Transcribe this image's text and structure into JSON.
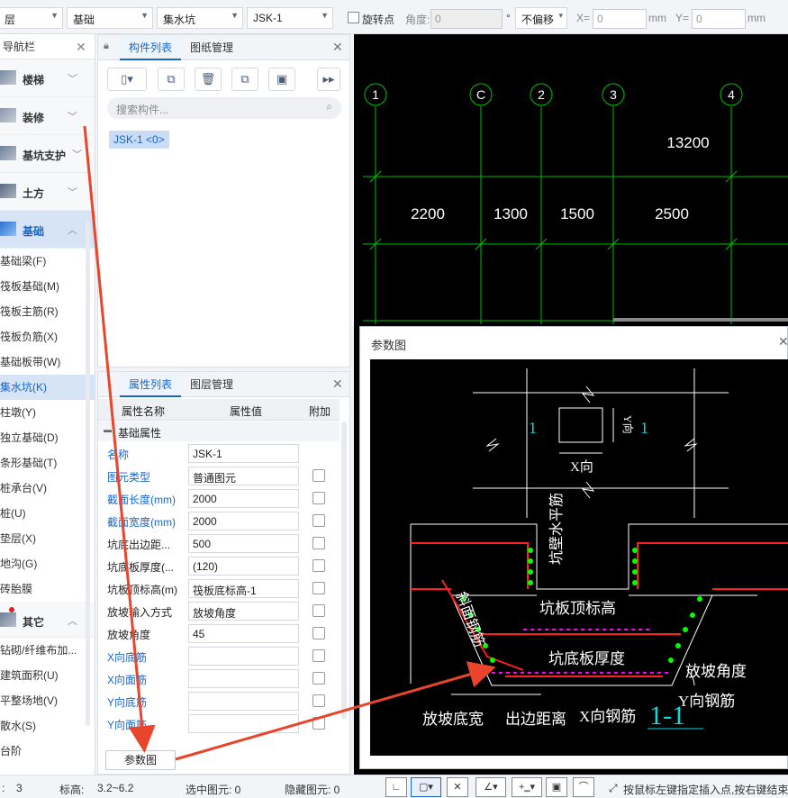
{
  "toolbar": {
    "floor": "层",
    "category": "基础",
    "type": "集水坑",
    "component": "JSK-1",
    "rotate_label": "旋转点",
    "angle_label": "角度:",
    "angle_value": "0",
    "degree": "°",
    "offset_option": "不偏移",
    "x_label": "X=",
    "x_value": "0",
    "x_unit": "mm",
    "y_label": "Y=",
    "y_value": "0",
    "y_unit": "mm"
  },
  "nav": {
    "title": "导航栏",
    "categories": [
      {
        "label": "楼梯"
      },
      {
        "label": "装修"
      },
      {
        "label": "基坑支护"
      },
      {
        "label": "土方"
      },
      {
        "label": "基础"
      }
    ],
    "items": [
      "基础梁(F)",
      "筏板基础(M)",
      "筏板主筋(R)",
      "筏板负筋(X)",
      "基础板带(W)",
      "集水坑(K)",
      "柱墩(Y)",
      "独立基础(D)",
      "条形基础(T)",
      "桩承台(V)",
      "桩(U)",
      "垫层(X)",
      "地沟(G)",
      "砖胎膜"
    ],
    "other_category": "其它",
    "other_items": [
      "钻砌/纤维布加...",
      "建筑面积(U)",
      "平整场地(V)",
      "散水(S)",
      "台阶"
    ]
  },
  "component_panel": {
    "tabs": [
      "构件列表",
      "图纸管理"
    ],
    "search_placeholder": "搜索构件...",
    "component_tag": "JSK-1 <0>"
  },
  "property_panel": {
    "tabs": [
      "属性列表",
      "图层管理"
    ],
    "headers": [
      "属性名称",
      "属性值",
      "附加"
    ],
    "group": "基础属性",
    "rows": [
      {
        "name": "名称",
        "value": "JSK-1",
        "blue": true,
        "check": false
      },
      {
        "name": "图元类型",
        "value": "普通图元",
        "blue": true,
        "check": true
      },
      {
        "name": "截面长度(mm)",
        "value": "2000",
        "blue": true,
        "check": true
      },
      {
        "name": "截面宽度(mm)",
        "value": "2000",
        "blue": true,
        "check": true
      },
      {
        "name": "坑底出边距...",
        "value": "500",
        "blue": false,
        "check": true
      },
      {
        "name": "坑底板厚度(...",
        "value": "(120)",
        "blue": false,
        "check": true
      },
      {
        "name": "坑板顶标高(m)",
        "value": "筏板底标高-1",
        "blue": false,
        "check": true
      },
      {
        "name": "放坡输入方式",
        "value": "放坡角度",
        "blue": false,
        "check": true
      },
      {
        "name": "放坡角度",
        "value": "45",
        "blue": false,
        "check": true
      },
      {
        "name": "X向底筋",
        "value": "",
        "blue": true,
        "check": true
      },
      {
        "name": "X向面筋",
        "value": "",
        "blue": true,
        "check": true
      },
      {
        "name": "Y向底筋",
        "value": "",
        "blue": true,
        "check": true
      },
      {
        "name": "Y向面筋",
        "value": "",
        "blue": true,
        "check": true
      }
    ],
    "param_button": "参数图"
  },
  "canvas": {
    "axes": [
      "1",
      "C",
      "2",
      "3",
      "4"
    ],
    "dims_top": "13200",
    "dims_mid": [
      "2200",
      "1300",
      "1500",
      "2500"
    ]
  },
  "param_dialog": {
    "title": "参数图",
    "sec_label_left": "1",
    "sec_label_right": "1",
    "y_dir": "Y向",
    "x_dir": "X向",
    "wall_rebar": "坑壁水平筋",
    "top_elev": "坑板顶标高",
    "slope_rebar": "斜面钢筋",
    "bottom_thick": "坑底板厚度",
    "slope_angle": "放坡角度",
    "y_rebar": "Y向钢筋",
    "x_rebar": "X向钢筋",
    "slope_width": "放坡底宽",
    "edge_dist": "出边距离",
    "section": "1-1"
  },
  "status": {
    "count": "3",
    "elev_label": "标高:",
    "elev_value": "3.2~6.2",
    "selected": "选中图元: 0",
    "hidden": "隐藏图元: 0",
    "hint": "按鼠标左键指定插入点,按右键结束"
  },
  "colors": {
    "accent": "#1a66c8",
    "grid": "#00c000",
    "rebar_red": "#ff2020",
    "rebar_green": "#00ff00",
    "rebar_magenta": "#ff00ff",
    "arrow": "#e8452c"
  }
}
